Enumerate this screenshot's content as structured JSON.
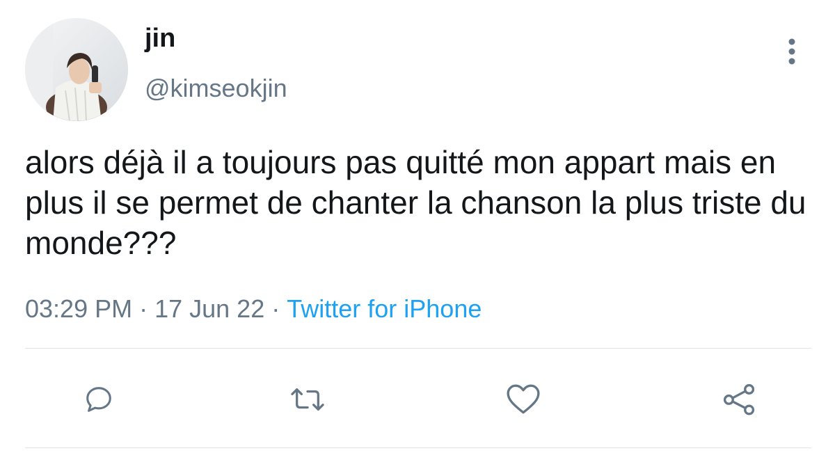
{
  "author": {
    "display_name": "jin",
    "handle": "@kimseokjin"
  },
  "tweet": {
    "text": "alors déjà il a toujours pas quitté mon appart mais en plus il se permet de chanter la chanson la plus triste du monde???",
    "time": "03:29 PM",
    "separator": "·",
    "date": "17 Jun 22",
    "source": "Twitter for iPhone"
  },
  "actions": {
    "icons": [
      "reply-icon",
      "retweet-icon",
      "like-icon",
      "share-icon"
    ]
  },
  "colors": {
    "text": "#14171a",
    "secondary": "#657786",
    "link": "#1da1f2",
    "divider": "#dfe3e7"
  }
}
